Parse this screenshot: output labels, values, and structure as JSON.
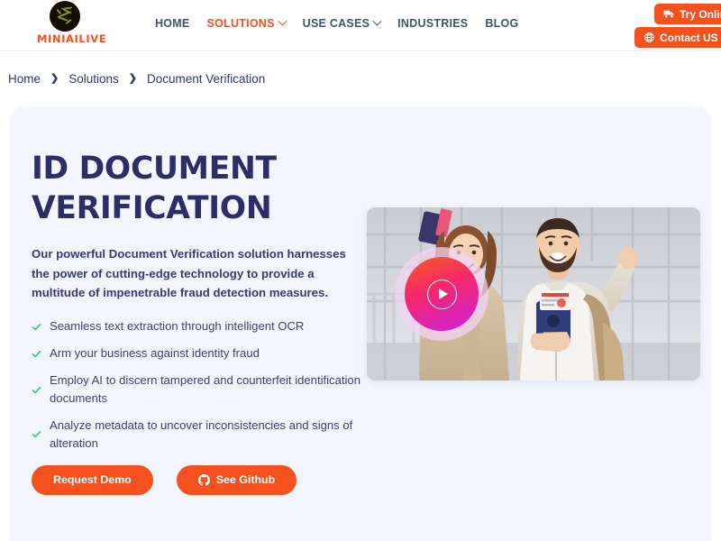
{
  "header": {
    "logo": {
      "text": "MINIAILIVE",
      "mark": "palm-circle-logo"
    },
    "nav": [
      {
        "label": "HOME",
        "active": false,
        "has_chevron": false
      },
      {
        "label": "SOLUTIONS",
        "active": true,
        "has_chevron": true
      },
      {
        "label": "USE CASES",
        "active": false,
        "has_chevron": true
      },
      {
        "label": "INDUSTRIES",
        "active": false,
        "has_chevron": false
      },
      {
        "label": "BLOG",
        "active": false,
        "has_chevron": false
      }
    ],
    "buttons": {
      "try_online": {
        "label": "Try Online",
        "icon": "truck-icon"
      },
      "contact_us": {
        "label": "Contact US",
        "icon": "globe-icon"
      }
    },
    "accent_color": "#f4511e",
    "nav_color": "#3c566b"
  },
  "breadcrumb": {
    "separator": "❯",
    "items": [
      {
        "label": "Home"
      },
      {
        "label": "Solutions"
      },
      {
        "label": "Document Verification"
      }
    ]
  },
  "hero": {
    "title": "ID DOCUMENT VERIFICATION",
    "description": "Our powerful Document Verification solution harnesses the power of cutting-edge technology to provide a multitude of impenetrable fraud detection measures.",
    "features": [
      {
        "text": "Seamless text extraction through intelligent OCR"
      },
      {
        "text": "Arm your business against identity fraud"
      },
      {
        "text": "Employ AI to discern tampered and counterfeit identification documents"
      },
      {
        "text": "Analyze metadata to uncover inconsistencies and signs of alteration"
      }
    ],
    "cta": {
      "demo": {
        "label": "Request Demo"
      },
      "github": {
        "label": "See Github",
        "icon": "github-icon"
      }
    },
    "media": {
      "alt": "Smiling couple at airport holding passports and boarding passes",
      "play_button": "play-icon"
    },
    "background_color": "#f3f6fd",
    "title_color": "#2c2f66",
    "check_color": "#3ec96f"
  }
}
